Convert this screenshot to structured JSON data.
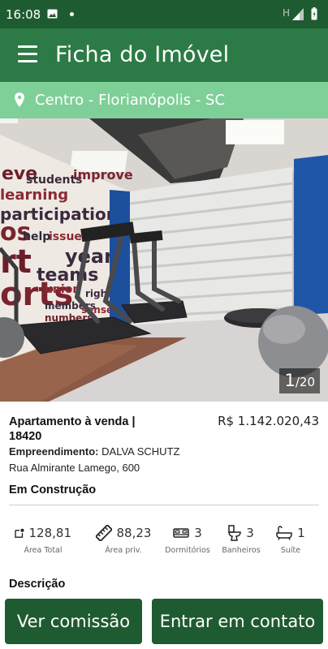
{
  "status_bar": {
    "time": "16:08",
    "network_letter": "H"
  },
  "header": {
    "title": "Ficha do Imóvel",
    "menu_icon": "hamburger-menu-icon"
  },
  "location": {
    "text": "Centro - Florianópolis - SC",
    "icon": "map-pin-icon"
  },
  "gallery": {
    "current": "1",
    "total": "/20"
  },
  "property": {
    "title": "Apartamento à venda | 18420",
    "price": "R$ 1.142.020,43",
    "development_label": "Empreendimento:",
    "development_name": "DALVA SCHUTZ",
    "address": "Rua Almirante Lamego, 600",
    "status": "Em Construção"
  },
  "features": [
    {
      "value": "128,81",
      "label": "Área Total",
      "icon": "total-area-icon"
    },
    {
      "value": "88,23",
      "label": "Área priv.",
      "icon": "ruler-icon"
    },
    {
      "value": "3",
      "label": "Dormitórios",
      "icon": "bed-icon"
    },
    {
      "value": "3",
      "label": "Banheiros",
      "icon": "toilet-icon"
    },
    {
      "value": "1",
      "label": "Suíte",
      "icon": "bathtub-icon"
    }
  ],
  "description": {
    "title": "Descrição"
  },
  "actions": {
    "commission": "Ver comissão",
    "contact": "Entrar em contato"
  },
  "colors": {
    "status_bar": "#1f5b31",
    "app_bar": "#2c7a45",
    "location_bar": "#7fcf98",
    "button": "#1f5b31"
  }
}
